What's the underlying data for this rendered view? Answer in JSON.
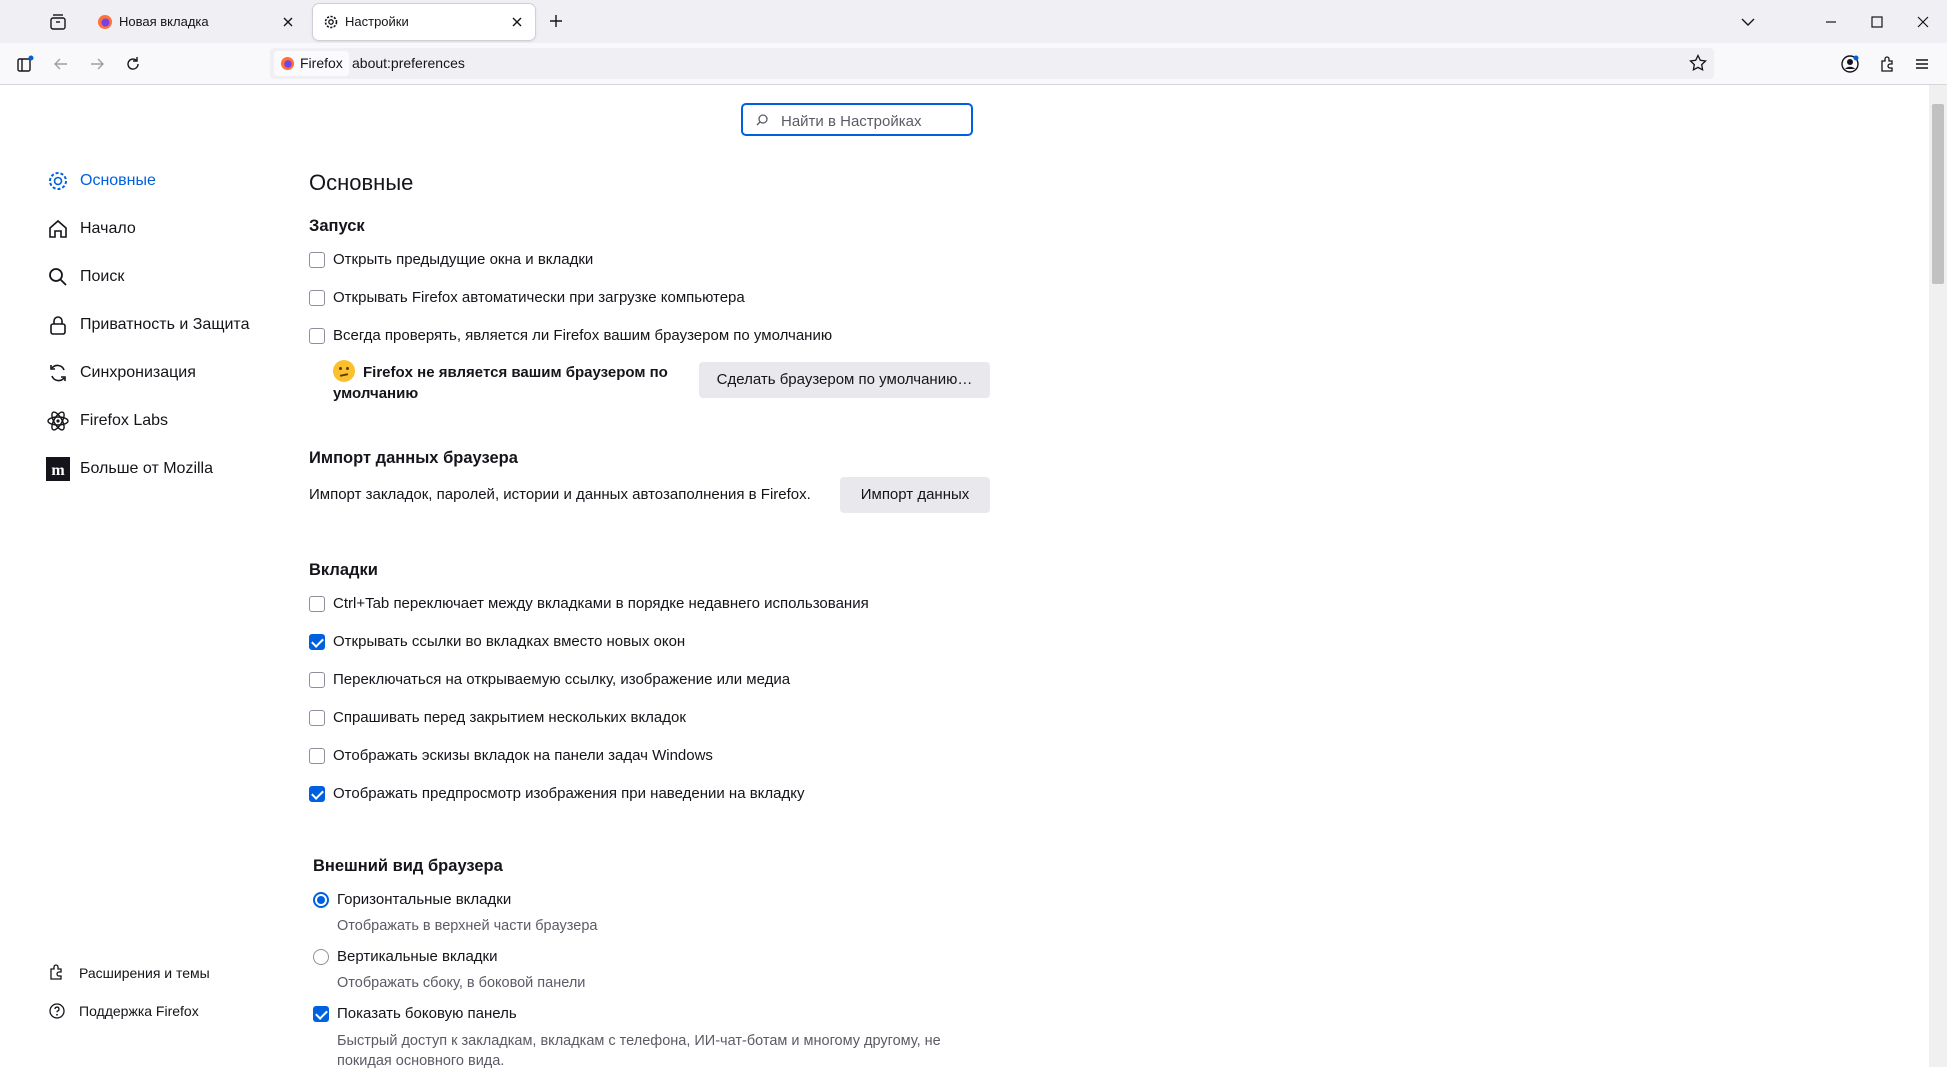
{
  "browser": {
    "tabs": [
      {
        "label": "Новая вкладка",
        "active": false
      },
      {
        "label": "Настройки",
        "active": true
      }
    ],
    "identity_label": "Firefox",
    "url": "about:preferences"
  },
  "search": {
    "placeholder": "Найти в Настройках"
  },
  "sidebar": {
    "categories": [
      {
        "label": "Основные",
        "icon": "gear-icon",
        "selected": true
      },
      {
        "label": "Начало",
        "icon": "home-icon"
      },
      {
        "label": "Поиск",
        "icon": "search-icon"
      },
      {
        "label": "Приватность и Защита",
        "icon": "lock-icon"
      },
      {
        "label": "Синхронизация",
        "icon": "sync-icon"
      },
      {
        "label": "Firefox Labs",
        "icon": "labs-icon"
      },
      {
        "label": "Больше от Mozilla",
        "icon": "mozilla-icon"
      }
    ],
    "footer": [
      {
        "label": "Расширения и темы",
        "icon": "extensions-icon"
      },
      {
        "label": "Поддержка Firefox",
        "icon": "help-icon"
      }
    ]
  },
  "main": {
    "title": "Основные",
    "startup": {
      "heading": "Запуск",
      "opt1": "Открыть предыдущие окна и вкладки",
      "opt2": "Открывать Firefox автоматически при загрузке компьютера",
      "opt3": "Всегда проверять, является ли Firefox вашим браузером по умолчанию",
      "not_default": "Firefox не является вашим браузером по умолчанию",
      "make_default_button": "Сделать браузером по умолчанию…"
    },
    "import": {
      "heading": "Импорт данных браузера",
      "description": "Импорт закладок, паролей, истории и данных автозаполнения в Firefox.",
      "button": "Импорт данных"
    },
    "tabs": {
      "heading": "Вкладки",
      "opt1": "Ctrl+Tab переключает между вкладками в порядке недавнего использования",
      "opt2": "Открывать ссылки во вкладках вместо новых окон",
      "opt3": "Переключаться на открываемую ссылку, изображение или медиа",
      "opt4": "Спрашивать перед закрытием нескольких вкладок",
      "opt5": "Отображать эскизы вкладок на панели задач Windows",
      "opt6": "Отображать предпросмотр изображения при наведении на вкладку"
    },
    "appearance": {
      "heading": "Внешний вид браузера",
      "horizontal": "Горизонтальные вкладки",
      "horizontal_desc": "Отображать в верхней части браузера",
      "vertical": "Вертикальные вкладки",
      "vertical_desc": "Отображать сбоку, в боковой панели",
      "sidebar": "Показать боковую панель",
      "sidebar_desc": "Быстрый доступ к закладкам, вкладкам с телефона, ИИ-чат-ботам и многому другому, не покидая основного вида."
    }
  },
  "colors": {
    "accent": "#0061e0",
    "tabstrip": "#f0f0f4"
  }
}
